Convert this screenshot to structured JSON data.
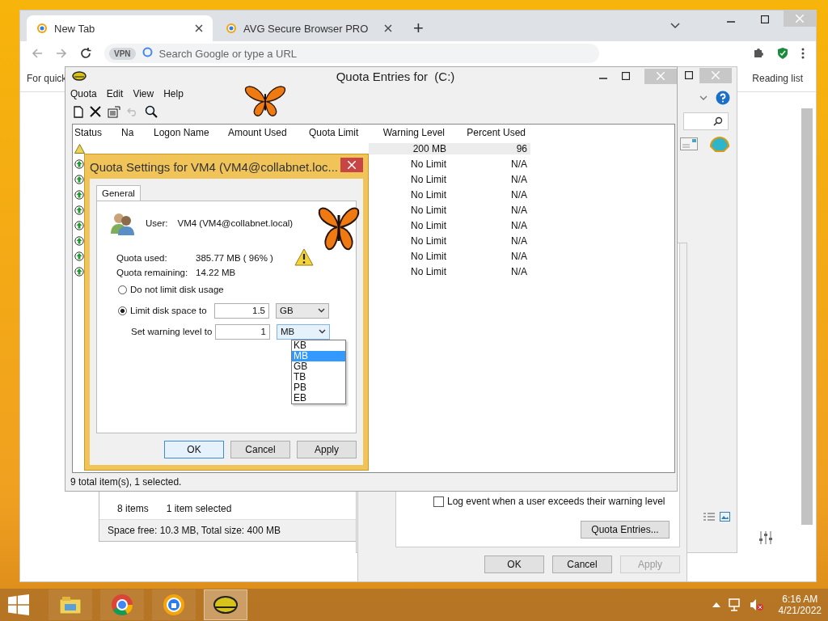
{
  "browser": {
    "tabs": [
      {
        "title": "New Tab",
        "selected": true
      },
      {
        "title": "AVG Secure Browser PRO",
        "selected": false
      }
    ],
    "new_tab": "+",
    "vpn_badge": "VPN",
    "address_placeholder": "Search Google or type a URL",
    "bookmarks_hint": "For quick",
    "reading_list": "Reading list"
  },
  "explorer": {
    "item_count": "8 items",
    "selection": "1 item selected",
    "status": "Space free: 10.3 MB, Total size: 400 MB"
  },
  "properties": {
    "log_event": {
      "label": "Log event when a user exceeds their warning level",
      "checked": false
    },
    "quota_entries_button": "Quota Entries...",
    "buttons": [
      {
        "label": "OK",
        "disabled": false
      },
      {
        "label": "Cancel",
        "disabled": false
      },
      {
        "label": "Apply",
        "disabled": true
      }
    ]
  },
  "quota_window": {
    "title": "Quota Entries for  (C:)",
    "menu": [
      "Quota",
      "Edit",
      "View",
      "Help"
    ],
    "columns": [
      "Status",
      "Na",
      "Logon Name",
      "Amount Used",
      "Quota Limit",
      "Warning Level",
      "Percent Used"
    ],
    "rows": [
      {
        "warning": true,
        "warning_level": "200 MB",
        "percent_used": "96",
        "selected": true
      },
      {
        "warning": false,
        "warning_level": "No Limit",
        "percent_used": "N/A",
        "selected": false
      },
      {
        "warning": false,
        "warning_level": "No Limit",
        "percent_used": "N/A",
        "selected": false
      },
      {
        "warning": false,
        "warning_level": "No Limit",
        "percent_used": "N/A",
        "selected": false
      },
      {
        "warning": false,
        "warning_level": "No Limit",
        "percent_used": "N/A",
        "selected": false
      },
      {
        "warning": false,
        "warning_level": "No Limit",
        "percent_used": "N/A",
        "selected": false
      },
      {
        "warning": false,
        "warning_level": "No Limit",
        "percent_used": "N/A",
        "selected": false
      },
      {
        "warning": false,
        "warning_level": "No Limit",
        "percent_used": "N/A",
        "selected": false
      },
      {
        "warning": false,
        "warning_level": "No Limit",
        "percent_used": "N/A",
        "selected": false
      }
    ],
    "status_bar": "9 total item(s), 1 selected."
  },
  "dialog": {
    "title": "Quota Settings for VM4 (VM4@collabnet.loc...",
    "tabs": [
      {
        "label": "General",
        "selected": true
      }
    ],
    "user_label": "User:",
    "user": "VM4 (VM4@collabnet.local)",
    "quota_used_label": "Quota used:",
    "quota_used": "385.77 MB ( 96% )",
    "remaining_label": "Quota remaining:",
    "remaining": "14.22 MB",
    "options": [
      {
        "label": "Do not limit disk usage",
        "selected": false
      },
      {
        "label": "Limit disk space to",
        "selected": true
      }
    ],
    "limit_value": "1.5",
    "limit_unit": "GB",
    "warning_label": "Set warning level to",
    "warning_value": "1",
    "warning_unit": "MB",
    "unit_options": [
      {
        "label": "KB",
        "selected": false
      },
      {
        "label": "MB",
        "selected": true
      },
      {
        "label": "GB",
        "selected": false
      },
      {
        "label": "TB",
        "selected": false
      },
      {
        "label": "PB",
        "selected": false
      },
      {
        "label": "EB",
        "selected": false
      }
    ],
    "buttons": [
      "OK",
      "Cancel",
      "Apply"
    ]
  },
  "taskbar": {
    "time": "6:16 AM",
    "date": "4/21/2022"
  }
}
